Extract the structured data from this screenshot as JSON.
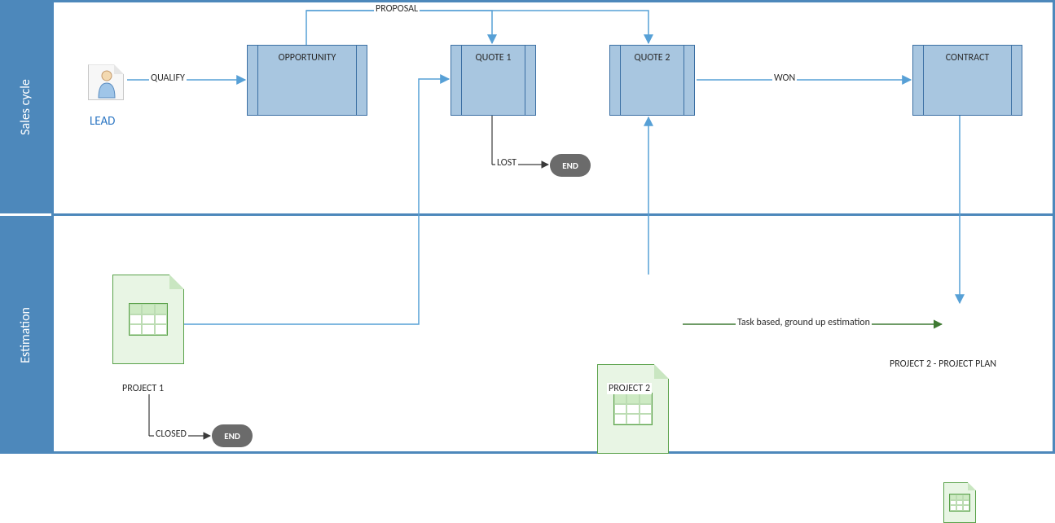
{
  "lanes": {
    "sales": "Sales cycle",
    "estimation": "Estimation"
  },
  "nodes": {
    "lead": "LEAD",
    "opportunity": "OPPORTUNITY",
    "quote1": "QUOTE 1",
    "quote2": "QUOTE 2",
    "contract": "CONTRACT",
    "end1": "END",
    "end2": "END",
    "project1": "PROJECT 1",
    "project2": "PROJECT 2",
    "project2plan": "PROJECT 2 - PROJECT PLAN"
  },
  "edges": {
    "qualify": "QUALIFY",
    "proposal": "PROPOSAL",
    "won": "WON",
    "lost": "LOST",
    "closed": "CLOSED",
    "taskbased": "Task based, ground up estimation"
  },
  "colors": {
    "lane": "#4d88bb",
    "process_fill": "#a8c6e0",
    "process_stroke": "#3b6fa3",
    "flow_blue": "#57a0d6",
    "flow_dark": "#3a3a3a",
    "flow_green": "#3f7a33",
    "terminator": "#6b6b6b",
    "doc_fill": "#e8f5e4",
    "doc_stroke": "#5aa24a",
    "lead_text": "#2f78c4"
  }
}
